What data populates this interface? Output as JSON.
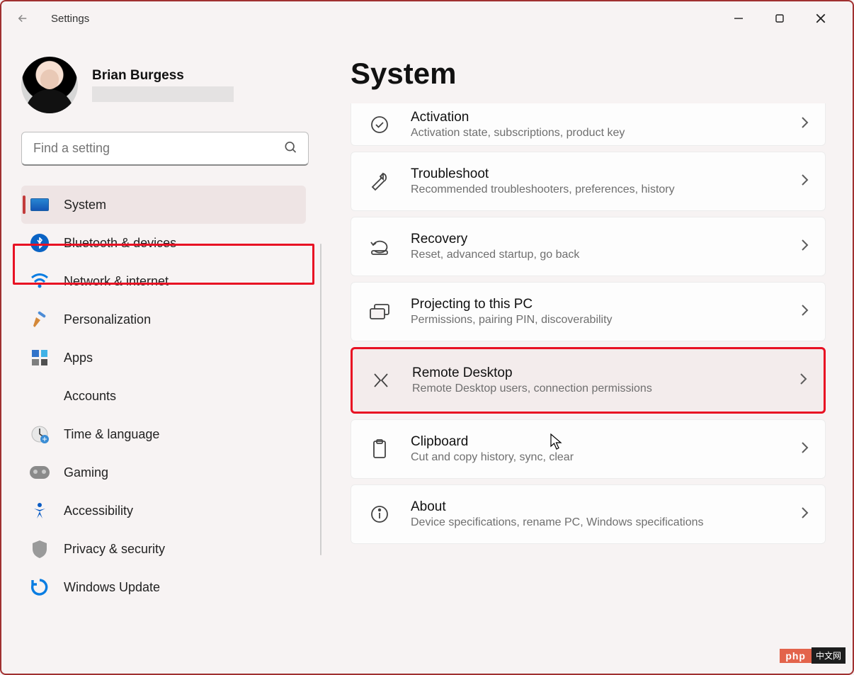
{
  "app": {
    "title": "Settings"
  },
  "user": {
    "name": "Brian Burgess"
  },
  "search": {
    "placeholder": "Find a setting"
  },
  "sidebar": {
    "items": [
      {
        "label": "System",
        "icon": "system-icon",
        "active": true
      },
      {
        "label": "Bluetooth & devices",
        "icon": "bluetooth-icon"
      },
      {
        "label": "Network & internet",
        "icon": "network-icon"
      },
      {
        "label": "Personalization",
        "icon": "personalization-icon"
      },
      {
        "label": "Apps",
        "icon": "apps-icon"
      },
      {
        "label": "Accounts",
        "icon": "accounts-icon"
      },
      {
        "label": "Time & language",
        "icon": "time-language-icon"
      },
      {
        "label": "Gaming",
        "icon": "gaming-icon"
      },
      {
        "label": "Accessibility",
        "icon": "accessibility-icon"
      },
      {
        "label": "Privacy & security",
        "icon": "privacy-icon"
      },
      {
        "label": "Windows Update",
        "icon": "windows-update-icon"
      }
    ]
  },
  "page": {
    "title": "System"
  },
  "cards": [
    {
      "title": "Activation",
      "sub": "Activation state, subscriptions, product key",
      "icon": "activation-icon"
    },
    {
      "title": "Troubleshoot",
      "sub": "Recommended troubleshooters, preferences, history",
      "icon": "troubleshoot-icon"
    },
    {
      "title": "Recovery",
      "sub": "Reset, advanced startup, go back",
      "icon": "recovery-icon"
    },
    {
      "title": "Projecting to this PC",
      "sub": "Permissions, pairing PIN, discoverability",
      "icon": "projecting-icon"
    },
    {
      "title": "Remote Desktop",
      "sub": "Remote Desktop users, connection permissions",
      "icon": "remote-desktop-icon",
      "highlight": true
    },
    {
      "title": "Clipboard",
      "sub": "Cut and copy history, sync, clear",
      "icon": "clipboard-icon"
    },
    {
      "title": "About",
      "sub": "Device specifications, rename PC, Windows specifications",
      "icon": "about-icon"
    }
  ],
  "watermark": {
    "left": "php",
    "right": "中文网"
  }
}
